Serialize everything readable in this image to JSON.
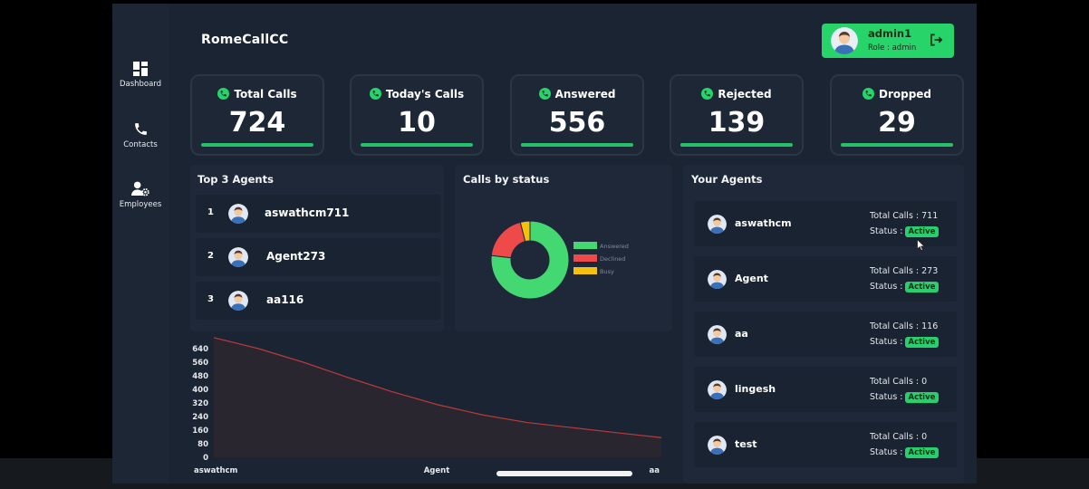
{
  "app": {
    "brand": "RomeCallCC"
  },
  "sidebar": {
    "items": [
      {
        "label": "Dashboard",
        "icon": "dashboard-icon"
      },
      {
        "label": "Contacts",
        "icon": "phone-icon"
      },
      {
        "label": "Employees",
        "icon": "user-gear-icon"
      }
    ]
  },
  "user": {
    "name": "admin1",
    "role": "Role : admin"
  },
  "stats": [
    {
      "title": "Total Calls",
      "value": "724"
    },
    {
      "title": "Today's Calls",
      "value": "10"
    },
    {
      "title": "Answered",
      "value": "556"
    },
    {
      "title": "Rejected",
      "value": "139"
    },
    {
      "title": "Dropped",
      "value": "29"
    }
  ],
  "top_agents": {
    "title": "Top 3 Agents",
    "items": [
      {
        "rank": "1",
        "name": "aswathcm711"
      },
      {
        "rank": "2",
        "name": "Agent273"
      },
      {
        "rank": "3",
        "name": "aa116"
      }
    ]
  },
  "calls_status": {
    "title": "Calls by status",
    "legend": [
      "Answered",
      "Declined",
      "Busy"
    ]
  },
  "your_agents": {
    "title": "Your Agents",
    "items": [
      {
        "name": "aswathcm",
        "total": "Total Calls : 711",
        "status_label": "Status :",
        "status": "Active"
      },
      {
        "name": "Agent",
        "total": "Total Calls : 273",
        "status_label": "Status :",
        "status": "Active"
      },
      {
        "name": "aa",
        "total": "Total Calls : 116",
        "status_label": "Status :",
        "status": "Active"
      },
      {
        "name": "lingesh",
        "total": "Total Calls : 0",
        "status_label": "Status :",
        "status": "Active"
      },
      {
        "name": "test",
        "total": "Total Calls : 0",
        "status_label": "Status :",
        "status": "Active"
      }
    ]
  },
  "colors": {
    "accent_green": "#26d46a",
    "declined_red": "#ef4a4a",
    "busy_yellow": "#f4c20d",
    "area_line": "#b83a3a"
  },
  "chart_data": [
    {
      "type": "pie",
      "categories": [
        "Answered",
        "Declined",
        "Busy"
      ],
      "values": [
        556,
        139,
        29
      ]
    },
    {
      "type": "area",
      "categories": [
        "aswathcm",
        "Agent",
        "aa"
      ],
      "y_ticks": [
        "640",
        "560",
        "480",
        "400",
        "320",
        "240",
        "160",
        "80",
        "0"
      ],
      "ylim": [
        0,
        640
      ],
      "points": [
        {
          "x": 0,
          "y": 705
        },
        {
          "x": 0.1,
          "y": 640
        },
        {
          "x": 0.2,
          "y": 560
        },
        {
          "x": 0.3,
          "y": 470
        },
        {
          "x": 0.4,
          "y": 385
        },
        {
          "x": 0.5,
          "y": 310
        },
        {
          "x": 0.6,
          "y": 250
        },
        {
          "x": 0.7,
          "y": 205
        },
        {
          "x": 0.8,
          "y": 175
        },
        {
          "x": 0.9,
          "y": 145
        },
        {
          "x": 1,
          "y": 116
        }
      ]
    }
  ]
}
